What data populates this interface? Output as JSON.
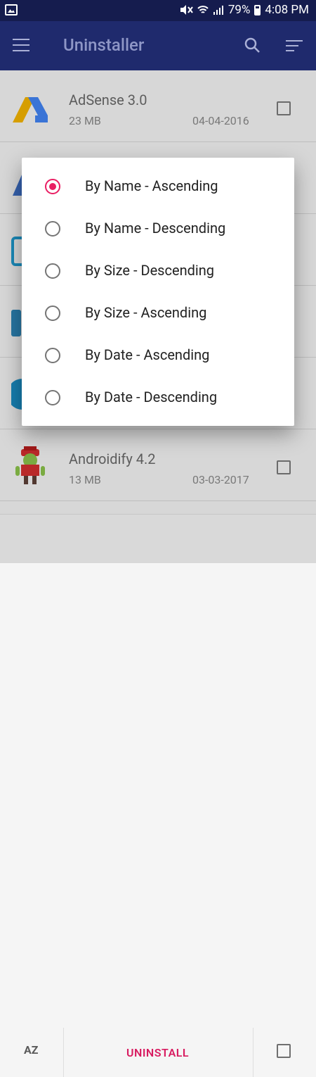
{
  "status_bar": {
    "battery": "79%",
    "time": "4:08 PM"
  },
  "toolbar": {
    "title": "Uninstaller"
  },
  "apps": [
    {
      "name": "AdSense 3.0",
      "size": "23 MB",
      "date": "04-04-2016"
    },
    {
      "name": "Androidify 4.2",
      "size": "13 MB",
      "date": "03-03-2017"
    }
  ],
  "bottom_bar": {
    "sort_label": "AZ",
    "uninstall_label": "UNINSTALL"
  },
  "sort_dialog": {
    "options": [
      {
        "label": "By Name - Ascending",
        "selected": true
      },
      {
        "label": "By Name - Descending",
        "selected": false
      },
      {
        "label": "By Size - Descending",
        "selected": false
      },
      {
        "label": "By Size - Ascending",
        "selected": false
      },
      {
        "label": "By Date - Ascending",
        "selected": false
      },
      {
        "label": "By Date - Descending",
        "selected": false
      }
    ]
  },
  "colors": {
    "toolbar": "#1f2a6d",
    "statusbar": "#151c4e",
    "accent": "#e91e63"
  },
  "icons": [
    "gallery-icon",
    "mute-icon",
    "wifi-icon",
    "signal-icon",
    "battery-icon",
    "menu-icon",
    "search-icon",
    "sort-icon",
    "az-sort-icon"
  ]
}
